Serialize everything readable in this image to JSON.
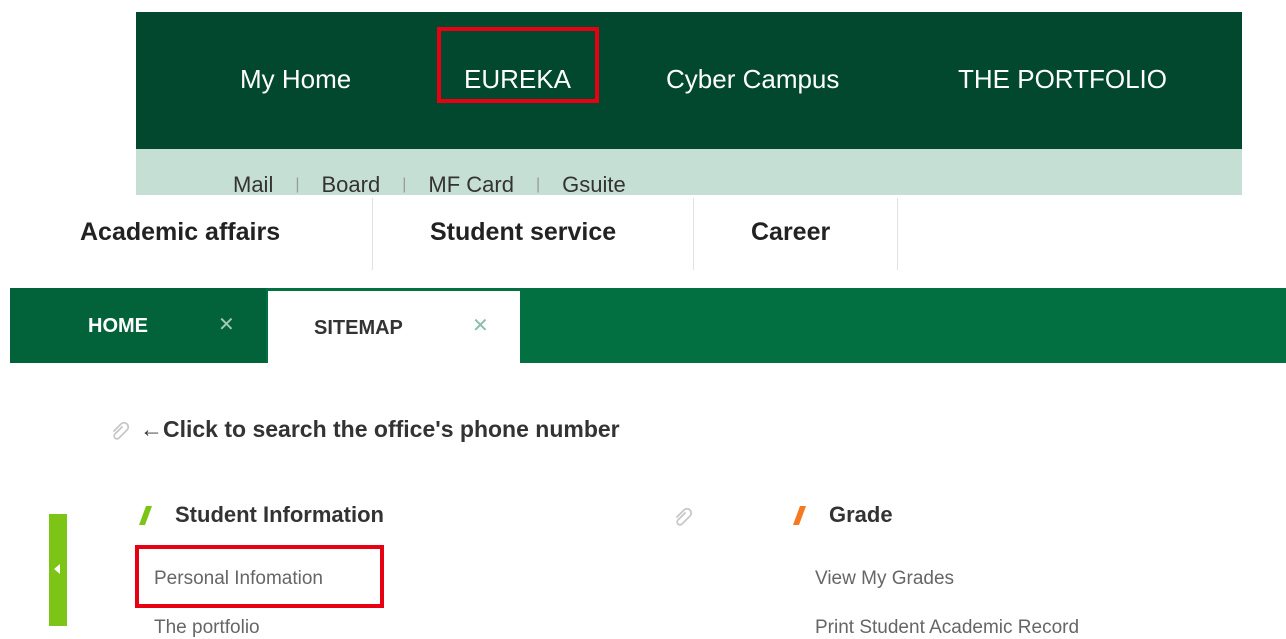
{
  "top_nav": {
    "items": [
      "My Home",
      "EUREKA",
      "Cyber Campus",
      "THE PORTFOLIO"
    ]
  },
  "sub_links": [
    "Mail",
    "Board",
    "MF Card",
    "Gsuite"
  ],
  "main_menu": [
    "Academic affairs",
    "Student service",
    "Career"
  ],
  "tabs": [
    {
      "label": "HOME",
      "close": "✕"
    },
    {
      "label": "SITEMAP",
      "close": "✕"
    }
  ],
  "info_text": "←Click to search the office's phone number",
  "sections": [
    {
      "title": "Student Information",
      "links": [
        "Personal Infomation",
        "The portfolio"
      ]
    },
    {
      "title": "Grade",
      "links": [
        "View My Grades",
        "Print Student Academic Record"
      ]
    }
  ],
  "colors": {
    "nav_bg": "#02482e",
    "tab_bg": "#037042",
    "highlight": "#e60012",
    "accent_green": "#7cc416",
    "accent_orange": "#f47920"
  },
  "icons": [
    "paperclip-icon",
    "close-icon",
    "slash-marker-icon",
    "collapse-arrow-icon"
  ]
}
